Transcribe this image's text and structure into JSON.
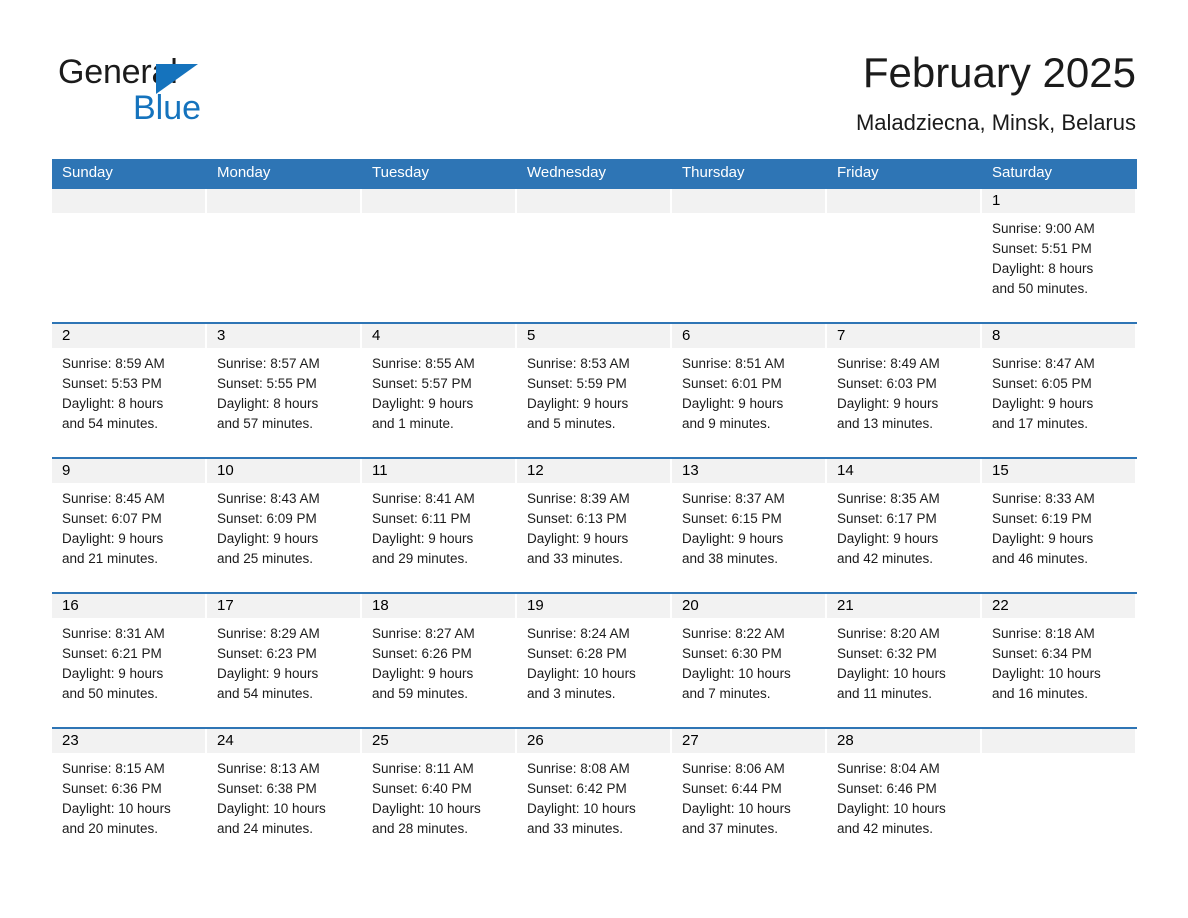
{
  "brand": {
    "name_part1": "General",
    "name_part2": "Blue",
    "accent_color": "#1573bd"
  },
  "header": {
    "title": "February 2025",
    "subtitle": "Maladziecna, Minsk, Belarus"
  },
  "theme": {
    "header_row_color": "#2e75b5",
    "day_band_color": "#f2f2f2",
    "row_divider_color": "#2e75b5"
  },
  "weekday_headers": [
    "Sunday",
    "Monday",
    "Tuesday",
    "Wednesday",
    "Thursday",
    "Friday",
    "Saturday"
  ],
  "labels": {
    "sunrise_prefix": "Sunrise:",
    "sunset_prefix": "Sunset:",
    "daylight_prefix": "Daylight:"
  },
  "weeks": [
    [
      {
        "day": "",
        "empty": true
      },
      {
        "day": "",
        "empty": true
      },
      {
        "day": "",
        "empty": true
      },
      {
        "day": "",
        "empty": true
      },
      {
        "day": "",
        "empty": true
      },
      {
        "day": "",
        "empty": true
      },
      {
        "day": "1",
        "sunrise": "Sunrise: 9:00 AM",
        "sunset": "Sunset: 5:51 PM",
        "daylight_l1": "Daylight: 8 hours",
        "daylight_l2": "and 50 minutes."
      }
    ],
    [
      {
        "day": "2",
        "sunrise": "Sunrise: 8:59 AM",
        "sunset": "Sunset: 5:53 PM",
        "daylight_l1": "Daylight: 8 hours",
        "daylight_l2": "and 54 minutes."
      },
      {
        "day": "3",
        "sunrise": "Sunrise: 8:57 AM",
        "sunset": "Sunset: 5:55 PM",
        "daylight_l1": "Daylight: 8 hours",
        "daylight_l2": "and 57 minutes."
      },
      {
        "day": "4",
        "sunrise": "Sunrise: 8:55 AM",
        "sunset": "Sunset: 5:57 PM",
        "daylight_l1": "Daylight: 9 hours",
        "daylight_l2": "and 1 minute."
      },
      {
        "day": "5",
        "sunrise": "Sunrise: 8:53 AM",
        "sunset": "Sunset: 5:59 PM",
        "daylight_l1": "Daylight: 9 hours",
        "daylight_l2": "and 5 minutes."
      },
      {
        "day": "6",
        "sunrise": "Sunrise: 8:51 AM",
        "sunset": "Sunset: 6:01 PM",
        "daylight_l1": "Daylight: 9 hours",
        "daylight_l2": "and 9 minutes."
      },
      {
        "day": "7",
        "sunrise": "Sunrise: 8:49 AM",
        "sunset": "Sunset: 6:03 PM",
        "daylight_l1": "Daylight: 9 hours",
        "daylight_l2": "and 13 minutes."
      },
      {
        "day": "8",
        "sunrise": "Sunrise: 8:47 AM",
        "sunset": "Sunset: 6:05 PM",
        "daylight_l1": "Daylight: 9 hours",
        "daylight_l2": "and 17 minutes."
      }
    ],
    [
      {
        "day": "9",
        "sunrise": "Sunrise: 8:45 AM",
        "sunset": "Sunset: 6:07 PM",
        "daylight_l1": "Daylight: 9 hours",
        "daylight_l2": "and 21 minutes."
      },
      {
        "day": "10",
        "sunrise": "Sunrise: 8:43 AM",
        "sunset": "Sunset: 6:09 PM",
        "daylight_l1": "Daylight: 9 hours",
        "daylight_l2": "and 25 minutes."
      },
      {
        "day": "11",
        "sunrise": "Sunrise: 8:41 AM",
        "sunset": "Sunset: 6:11 PM",
        "daylight_l1": "Daylight: 9 hours",
        "daylight_l2": "and 29 minutes."
      },
      {
        "day": "12",
        "sunrise": "Sunrise: 8:39 AM",
        "sunset": "Sunset: 6:13 PM",
        "daylight_l1": "Daylight: 9 hours",
        "daylight_l2": "and 33 minutes."
      },
      {
        "day": "13",
        "sunrise": "Sunrise: 8:37 AM",
        "sunset": "Sunset: 6:15 PM",
        "daylight_l1": "Daylight: 9 hours",
        "daylight_l2": "and 38 minutes."
      },
      {
        "day": "14",
        "sunrise": "Sunrise: 8:35 AM",
        "sunset": "Sunset: 6:17 PM",
        "daylight_l1": "Daylight: 9 hours",
        "daylight_l2": "and 42 minutes."
      },
      {
        "day": "15",
        "sunrise": "Sunrise: 8:33 AM",
        "sunset": "Sunset: 6:19 PM",
        "daylight_l1": "Daylight: 9 hours",
        "daylight_l2": "and 46 minutes."
      }
    ],
    [
      {
        "day": "16",
        "sunrise": "Sunrise: 8:31 AM",
        "sunset": "Sunset: 6:21 PM",
        "daylight_l1": "Daylight: 9 hours",
        "daylight_l2": "and 50 minutes."
      },
      {
        "day": "17",
        "sunrise": "Sunrise: 8:29 AM",
        "sunset": "Sunset: 6:23 PM",
        "daylight_l1": "Daylight: 9 hours",
        "daylight_l2": "and 54 minutes."
      },
      {
        "day": "18",
        "sunrise": "Sunrise: 8:27 AM",
        "sunset": "Sunset: 6:26 PM",
        "daylight_l1": "Daylight: 9 hours",
        "daylight_l2": "and 59 minutes."
      },
      {
        "day": "19",
        "sunrise": "Sunrise: 8:24 AM",
        "sunset": "Sunset: 6:28 PM",
        "daylight_l1": "Daylight: 10 hours",
        "daylight_l2": "and 3 minutes."
      },
      {
        "day": "20",
        "sunrise": "Sunrise: 8:22 AM",
        "sunset": "Sunset: 6:30 PM",
        "daylight_l1": "Daylight: 10 hours",
        "daylight_l2": "and 7 minutes."
      },
      {
        "day": "21",
        "sunrise": "Sunrise: 8:20 AM",
        "sunset": "Sunset: 6:32 PM",
        "daylight_l1": "Daylight: 10 hours",
        "daylight_l2": "and 11 minutes."
      },
      {
        "day": "22",
        "sunrise": "Sunrise: 8:18 AM",
        "sunset": "Sunset: 6:34 PM",
        "daylight_l1": "Daylight: 10 hours",
        "daylight_l2": "and 16 minutes."
      }
    ],
    [
      {
        "day": "23",
        "sunrise": "Sunrise: 8:15 AM",
        "sunset": "Sunset: 6:36 PM",
        "daylight_l1": "Daylight: 10 hours",
        "daylight_l2": "and 20 minutes."
      },
      {
        "day": "24",
        "sunrise": "Sunrise: 8:13 AM",
        "sunset": "Sunset: 6:38 PM",
        "daylight_l1": "Daylight: 10 hours",
        "daylight_l2": "and 24 minutes."
      },
      {
        "day": "25",
        "sunrise": "Sunrise: 8:11 AM",
        "sunset": "Sunset: 6:40 PM",
        "daylight_l1": "Daylight: 10 hours",
        "daylight_l2": "and 28 minutes."
      },
      {
        "day": "26",
        "sunrise": "Sunrise: 8:08 AM",
        "sunset": "Sunset: 6:42 PM",
        "daylight_l1": "Daylight: 10 hours",
        "daylight_l2": "and 33 minutes."
      },
      {
        "day": "27",
        "sunrise": "Sunrise: 8:06 AM",
        "sunset": "Sunset: 6:44 PM",
        "daylight_l1": "Daylight: 10 hours",
        "daylight_l2": "and 37 minutes."
      },
      {
        "day": "28",
        "sunrise": "Sunrise: 8:04 AM",
        "sunset": "Sunset: 6:46 PM",
        "daylight_l1": "Daylight: 10 hours",
        "daylight_l2": "and 42 minutes."
      },
      {
        "day": "",
        "empty": true
      }
    ]
  ]
}
